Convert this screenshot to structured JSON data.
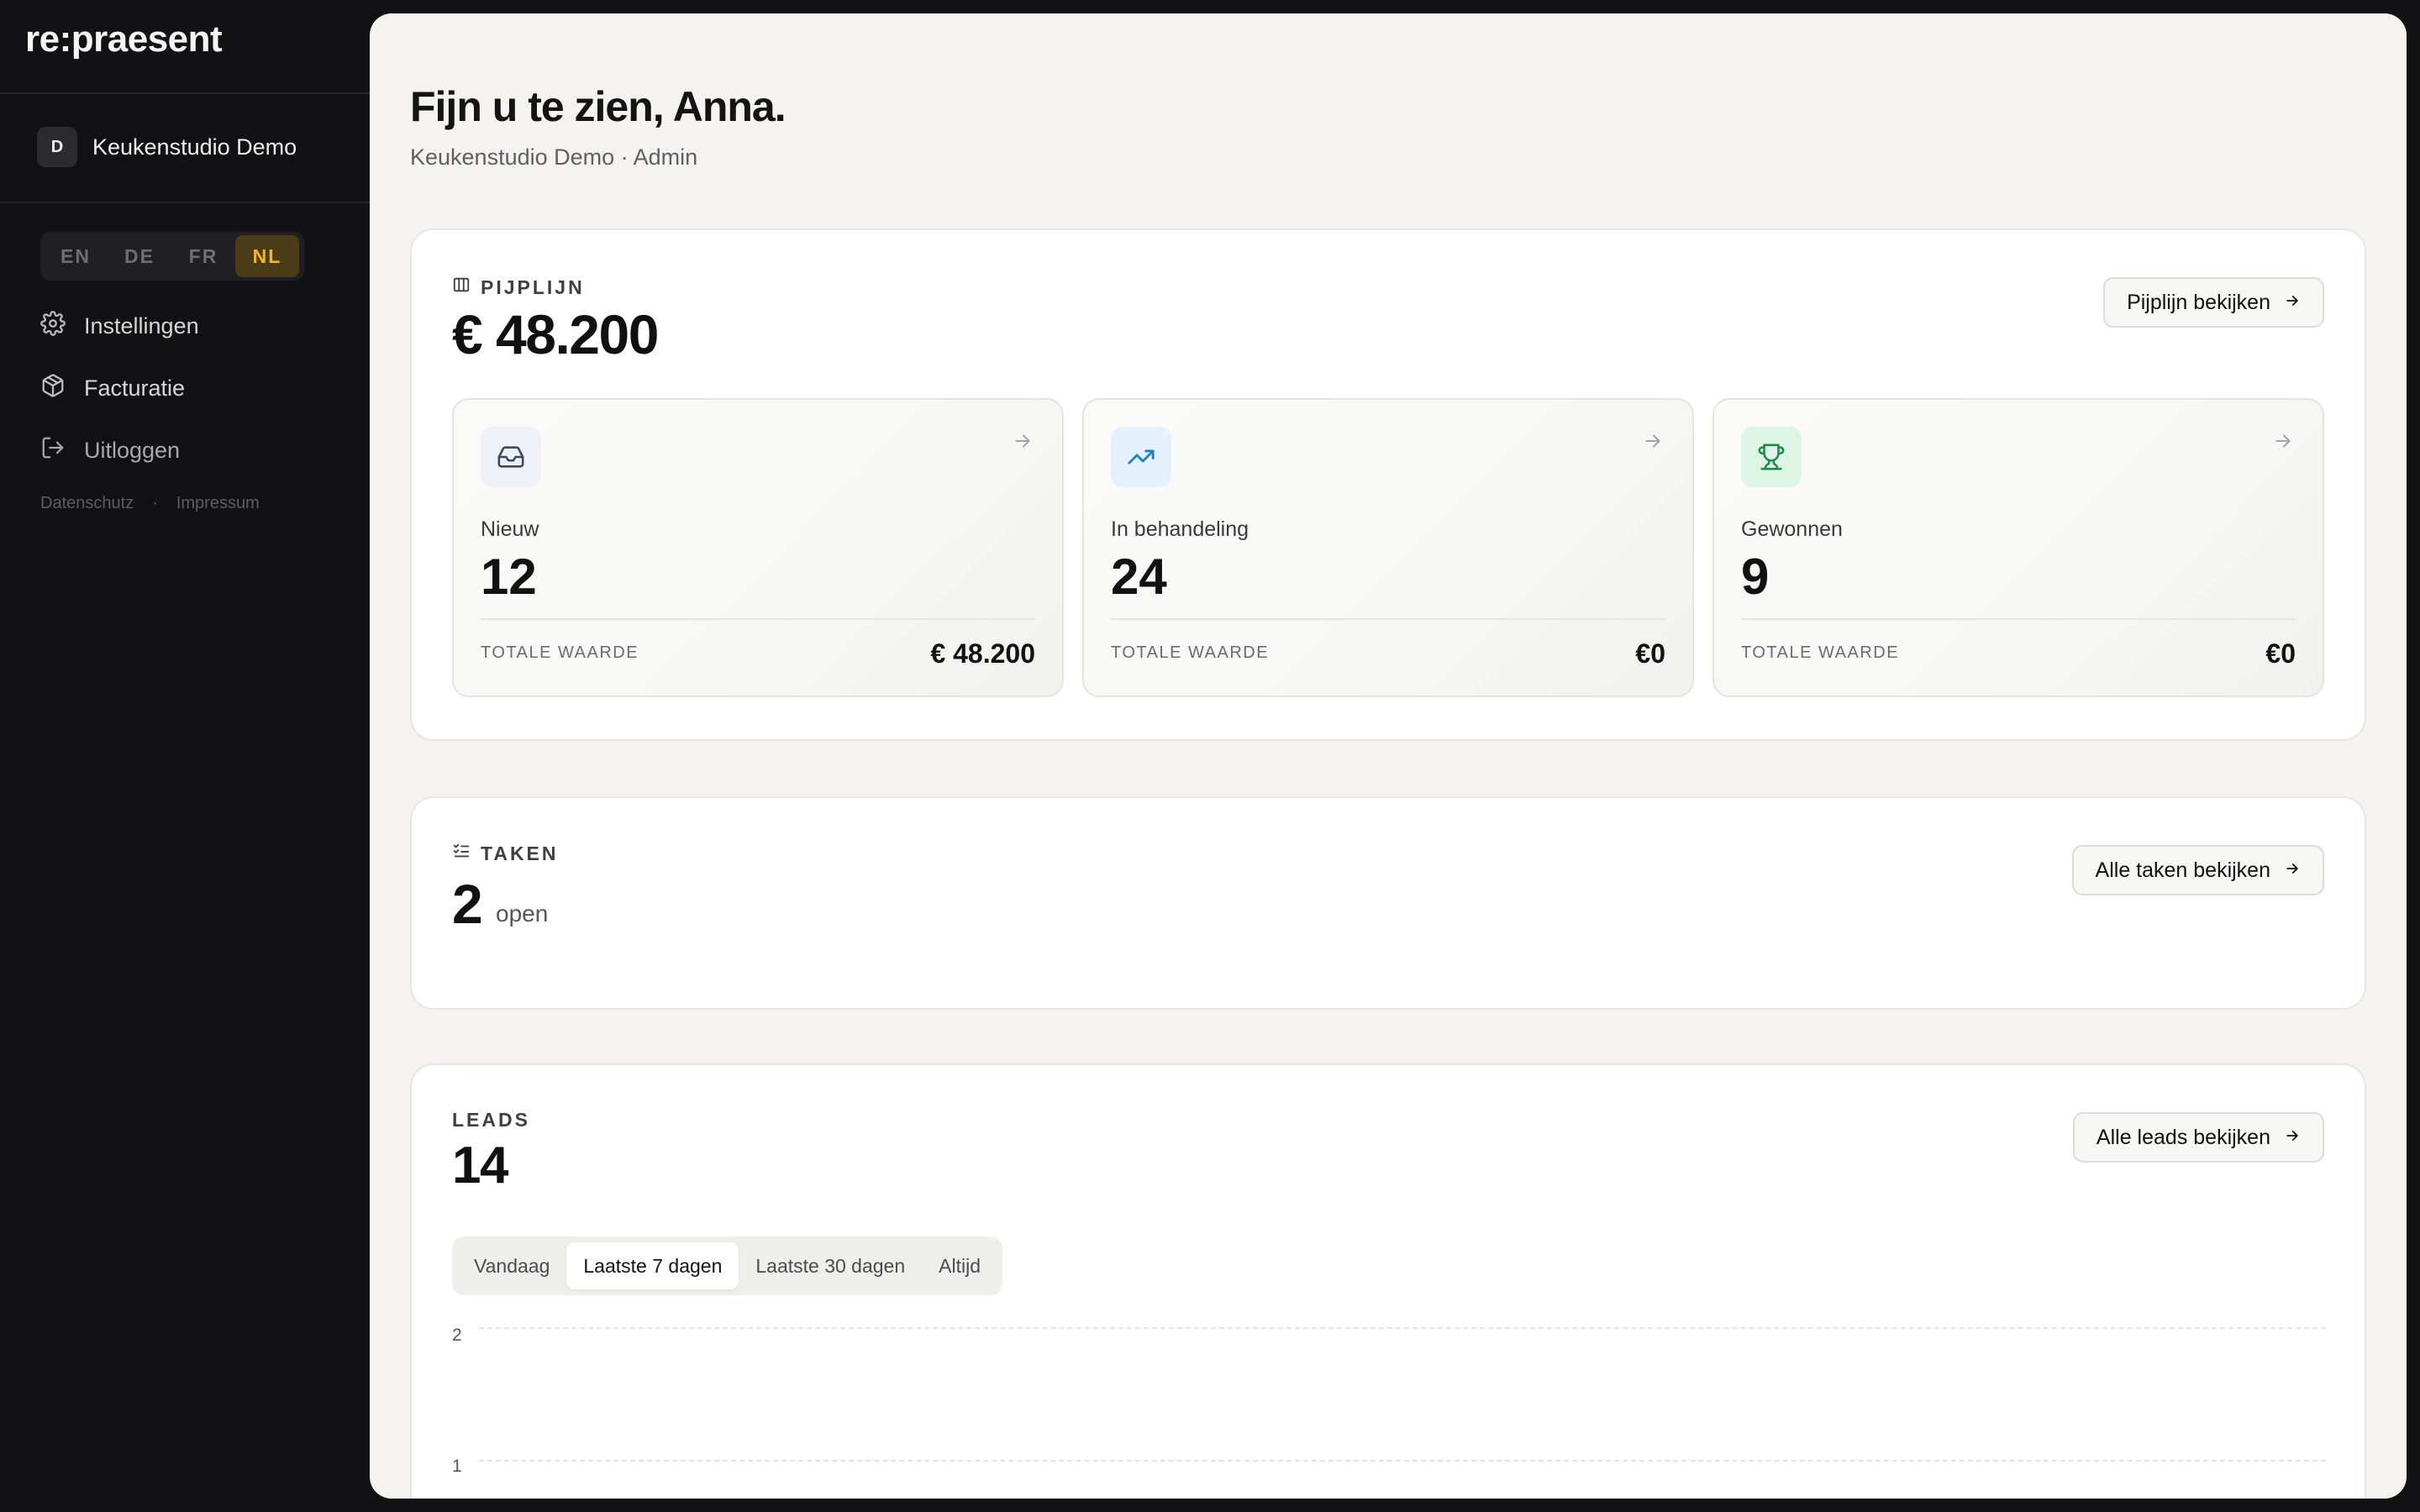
{
  "app": {
    "logo": "re:praesent"
  },
  "sidebar": {
    "workspace": {
      "initial": "D",
      "name": "Keukenstudio Demo"
    },
    "languages": [
      {
        "code": "EN",
        "active": false
      },
      {
        "code": "DE",
        "active": false
      },
      {
        "code": "FR",
        "active": false
      },
      {
        "code": "NL",
        "active": true
      }
    ],
    "nav": [
      {
        "label": "Instellingen",
        "icon": "gear-icon"
      },
      {
        "label": "Facturatie",
        "icon": "package-icon"
      },
      {
        "label": "Uitloggen",
        "icon": "logout-icon"
      }
    ],
    "legal": {
      "privacy": "Datenschutz",
      "separator": "·",
      "imprint": "Impressum"
    }
  },
  "header": {
    "greeting": "Fijn u te zien, Anna.",
    "subtitle": "Keukenstudio Demo · Admin"
  },
  "pipeline": {
    "label": "PIJPLIJN",
    "total": "€ 48.200",
    "button": "Pijplijn bekijken",
    "stages": [
      {
        "name": "Nieuw",
        "count": "12",
        "value_label": "TOTALE WAARDE",
        "value": "€ 48.200",
        "icon": "inbox-icon",
        "icon_bg": "#eef1f6",
        "icon_color": "#3b4a63"
      },
      {
        "name": "In behandeling",
        "count": "24",
        "value_label": "TOTALE WAARDE",
        "value": "€0",
        "icon": "trending-up-icon",
        "icon_bg": "#e3f1fc",
        "icon_color": "#1f7fc7"
      },
      {
        "name": "Gewonnen",
        "count": "9",
        "value_label": "TOTALE WAARDE",
        "value": "€0",
        "icon": "trophy-icon",
        "icon_bg": "#dcf5e6",
        "icon_color": "#1f8a4c"
      }
    ]
  },
  "tasks": {
    "label": "TAKEN",
    "count": "2",
    "suffix": "open",
    "button": "Alle taken bekijken"
  },
  "leads": {
    "label": "LEADS",
    "count": "14",
    "button": "Alle leads bekijken",
    "ranges": [
      {
        "label": "Vandaag",
        "active": false
      },
      {
        "label": "Laatste 7 dagen",
        "active": true
      },
      {
        "label": "Laatste 30 dagen",
        "active": false
      },
      {
        "label": "Altijd",
        "active": false
      }
    ],
    "chart_y_ticks": [
      "2",
      "1"
    ]
  },
  "colors": {
    "accent": "#f2b81e",
    "sidebar_bg": "#121214",
    "main_bg": "#f4f3ef"
  }
}
